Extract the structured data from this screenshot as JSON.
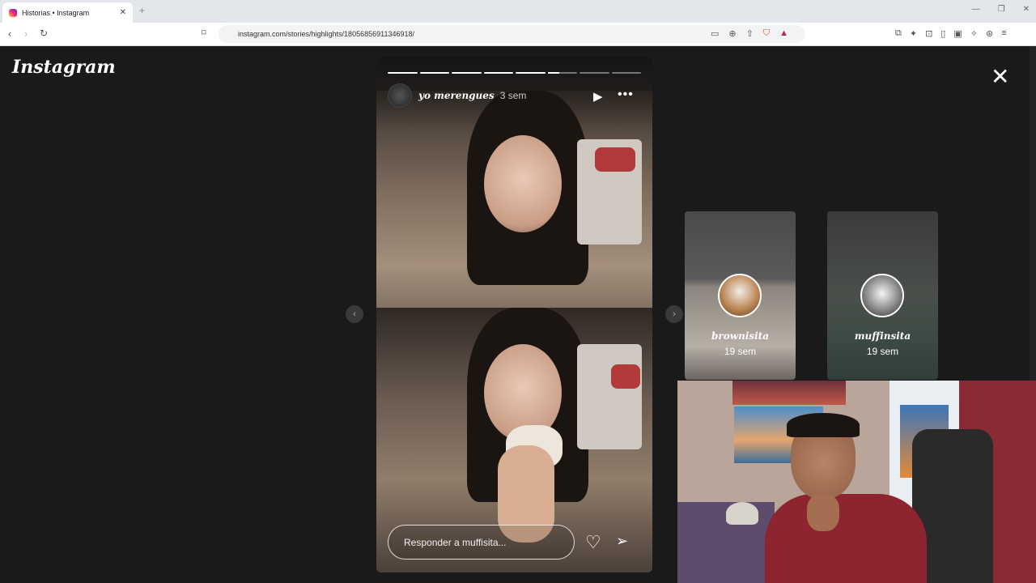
{
  "browser": {
    "tab_title": "Historias • Instagram",
    "tab_close": "✕",
    "new_tab": "+",
    "url": "instagram.com/stories/highlights/18056856911346918/"
  },
  "brand": {
    "logo": "Instagram"
  },
  "story": {
    "username": "yo merengues",
    "time": "3 sem",
    "reply_placeholder": "Responder a muffisita...",
    "segments_total": 8,
    "segments_done": 5,
    "current_segment_progress": 0.4
  },
  "next_stories": [
    {
      "name": "brownisita",
      "time": "19 sem"
    },
    {
      "name": "muffinsita",
      "time": "19 sem"
    }
  ],
  "icons": {
    "close": "close-icon",
    "play": "play-icon",
    "more": "more-icon",
    "heart": "heart-icon",
    "send": "send-icon"
  }
}
